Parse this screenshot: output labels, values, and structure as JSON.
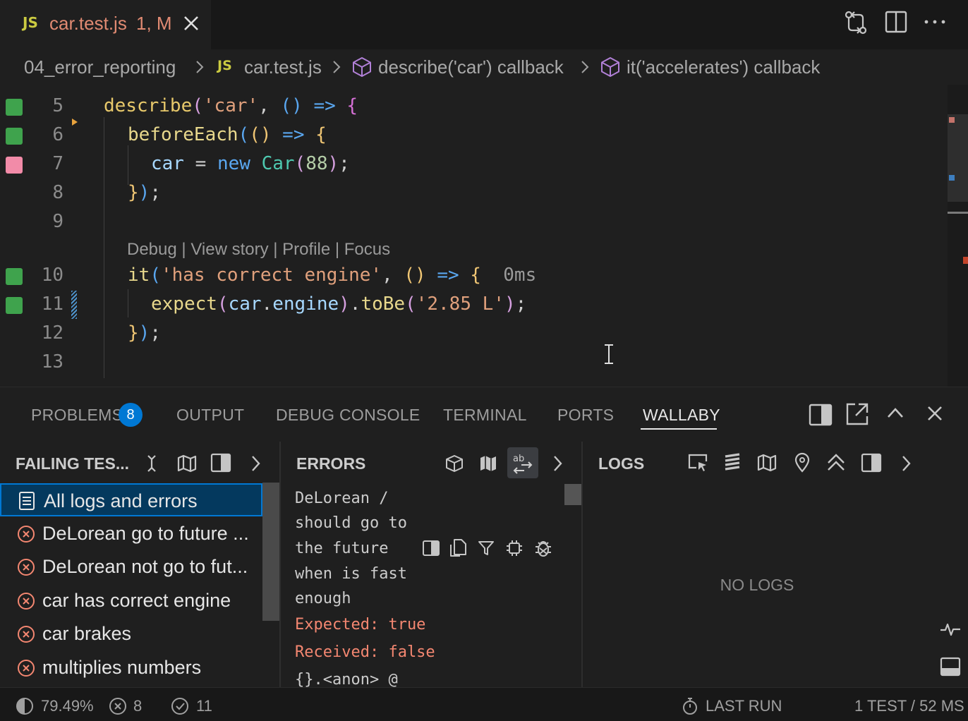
{
  "tab": {
    "lang_badge": "JS",
    "filename": "car.test.js",
    "status": "1, M"
  },
  "breadcrumb": [
    {
      "label": "04_error_reporting"
    },
    {
      "label": "car.test.js"
    },
    {
      "label": "describe('car') callback"
    },
    {
      "label": "it('accelerates') callback"
    }
  ],
  "editor": {
    "lines": {
      "l5": "5",
      "l6": "6",
      "l7": "7",
      "l8": "8",
      "l9": "9",
      "l10": "10",
      "l11": "11",
      "l12": "12",
      "l13": "13"
    },
    "codelens": {
      "debug": "Debug",
      "view_story": "View story",
      "profile": "Profile",
      "focus": "Focus",
      "sep": " | "
    },
    "test_time": "0ms",
    "coverage_colors": {
      "covered": "#3fa34d",
      "uncovered": "#f28ba8"
    }
  },
  "panel": {
    "tabs": {
      "problems": "PROBLEMS",
      "output": "OUTPUT",
      "debug_console": "DEBUG CONSOLE",
      "terminal": "TERMINAL",
      "ports": "PORTS",
      "wallaby": "WALLABY"
    },
    "problems_count": "8",
    "failing_tests": {
      "title": "FAILING TES...",
      "items": [
        {
          "label": "All logs and errors"
        },
        {
          "label": "DeLorean go to future ..."
        },
        {
          "label": "DeLorean not go to fut..."
        },
        {
          "label": "car has correct engine"
        },
        {
          "label": "car brakes"
        },
        {
          "label": "multiplies numbers"
        }
      ]
    },
    "errors": {
      "title": "ERRORS",
      "lines": [
        "DeLorean /",
        "should go to",
        "the future",
        "when is fast",
        "enough"
      ],
      "expected": "Expected: true",
      "received": "Received: false",
      "trace": "{}.<anon> @"
    },
    "logs": {
      "title": "LOGS",
      "empty": "NO LOGS"
    }
  },
  "status": {
    "coverage": "79.49%",
    "failed": "8",
    "passed": "11",
    "last_run": "LAST RUN",
    "summary": "1 TEST / 52 MS"
  },
  "colors": {
    "accent": "#0078d4",
    "error": "#f48771",
    "js_badge": "#cbcb41"
  }
}
